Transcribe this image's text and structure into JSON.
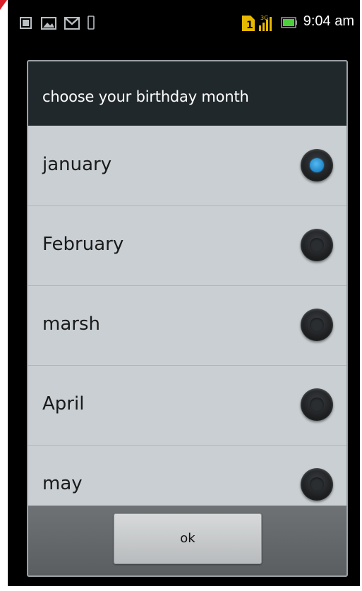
{
  "status_bar": {
    "time": "9:04 am",
    "network_label": "3G",
    "icons": [
      "notification-icon",
      "image-icon",
      "gmail-icon",
      "phone-icon",
      "sim-icon",
      "signal-icon",
      "battery-icon"
    ]
  },
  "dialog": {
    "title": "choose your birthday month",
    "options": [
      {
        "label": "january",
        "selected": true
      },
      {
        "label": "February",
        "selected": false
      },
      {
        "label": "marsh",
        "selected": false
      },
      {
        "label": "April",
        "selected": false
      },
      {
        "label": "may",
        "selected": false
      }
    ],
    "ok_label": "ok"
  },
  "colors": {
    "title_bar": "#20282b",
    "list_bg": "#c9cfd2",
    "radio_selected": "#1f86c9",
    "battery": "#4ccf3a",
    "sim": "#e6b800"
  }
}
